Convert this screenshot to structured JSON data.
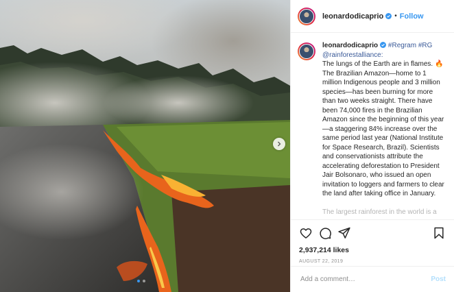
{
  "post": {
    "username": "leonardodicaprio",
    "follow_label": "Follow",
    "header_separator": "•",
    "caption": {
      "username": "leonardodicaprio",
      "tags": "#Regram #RG @rainforestalliance:",
      "paragraph_1": "The lungs of the Earth are in flames.",
      "paragraph_2": "The Brazilian Amazon—home to 1 million Indigenous people and 3 million species—has been burning for more than two weeks straight. There have been 74,000 fires in the Brazilian Amazon since the beginning of this year—a staggering 84% increase over the same period last year (National Institute for Space Research, Brazil). Scientists and conservationists attribute the accelerating deforestation to President Jair Bolsonaro, who issued an open invitation to loggers and farmers to clear the land after taking office in January.",
      "faded_line": "The largest rainforest in the world is a"
    },
    "likes": "2,937,214 likes",
    "date": "AUGUST 22, 2019",
    "comment_placeholder": "Add a comment…",
    "post_label": "Post",
    "carousel": {
      "slides": 2,
      "active_index": 0
    },
    "colors": {
      "accent_blue": "#3897f0",
      "post_disabled": "#b2dffc",
      "fire": "#e8641c"
    },
    "icons": {
      "like": "heart-icon",
      "comment": "comment-icon",
      "share": "paper-plane-icon",
      "save": "bookmark-icon",
      "verified": "verified-badge-icon",
      "next": "chevron-right-icon"
    }
  }
}
